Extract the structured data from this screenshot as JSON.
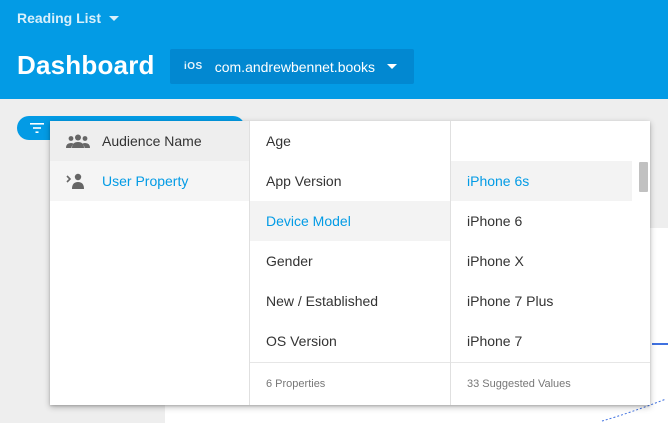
{
  "header": {
    "project_name": "Reading List",
    "page_title": "Dashboard",
    "app_platform": "iOS",
    "app_id": "com.andrewbennet.books",
    "bg_color": "#039be5"
  },
  "filter": {
    "icon": "filter-icon"
  },
  "dropdown": {
    "categories": [
      {
        "label": "Audience Name",
        "icon": "audience-icon"
      },
      {
        "label": "User Property",
        "icon": "user-property-icon"
      }
    ],
    "properties": [
      "Age",
      "App Version",
      "Device Model",
      "Gender",
      "New / Established",
      "OS Version"
    ],
    "properties_footer": "6 Properties",
    "values": [
      "iPhone 6s",
      "iPhone 6",
      "iPhone X",
      "iPhone 7 Plus",
      "iPhone 7"
    ],
    "values_footer": "33 Suggested Values",
    "accent_color": "#039be5"
  }
}
